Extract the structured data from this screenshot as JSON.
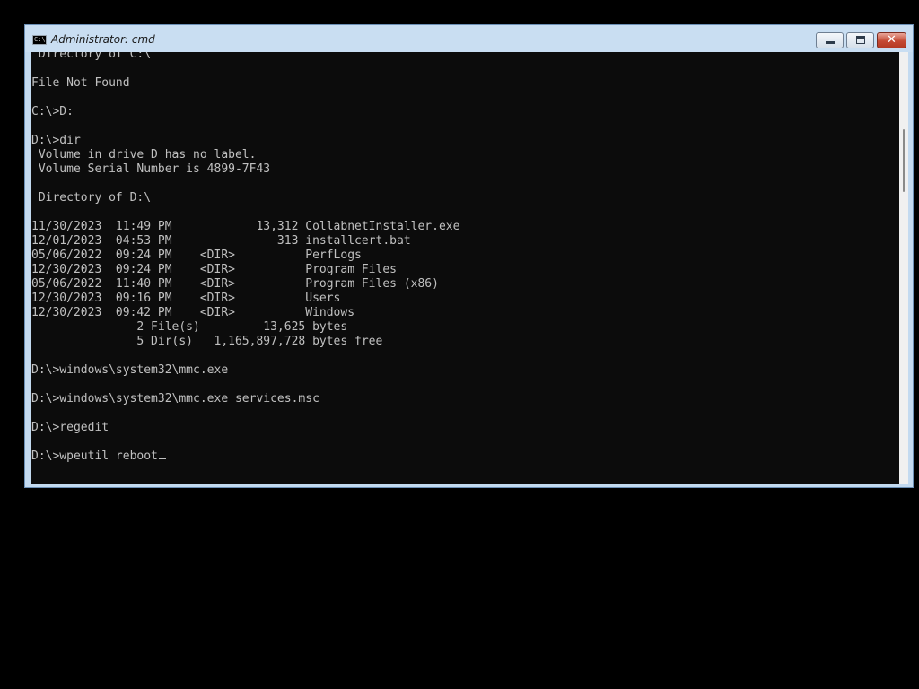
{
  "window": {
    "title": "Administrator: cmd",
    "icon_label": "C:\\"
  },
  "console": {
    "lines": [
      " Directory of C:\\",
      "",
      "File Not Found",
      "",
      "C:\\>D:",
      "",
      "D:\\>dir",
      " Volume in drive D has no label.",
      " Volume Serial Number is 4899-7F43",
      "",
      " Directory of D:\\",
      "",
      "11/30/2023  11:49 PM            13,312 CollabnetInstaller.exe",
      "12/01/2023  04:53 PM               313 installcert.bat",
      "05/06/2022  09:24 PM    <DIR>          PerfLogs",
      "12/30/2023  09:24 PM    <DIR>          Program Files",
      "05/06/2022  11:40 PM    <DIR>          Program Files (x86)",
      "12/30/2023  09:16 PM    <DIR>          Users",
      "12/30/2023  09:42 PM    <DIR>          Windows",
      "               2 File(s)         13,625 bytes",
      "               5 Dir(s)   1,165,897,728 bytes free",
      "",
      "D:\\>windows\\system32\\mmc.exe",
      "",
      "D:\\>windows\\system32\\mmc.exe services.msc",
      "",
      "D:\\>regedit",
      "",
      "D:\\>wpeutil reboot"
    ]
  },
  "icons": {
    "window_icon": "cmd-icon",
    "minimize": "minimize-icon",
    "maximize": "maximize-icon",
    "close": "close-icon"
  },
  "colors": {
    "console_bg": "#0c0c0c",
    "console_text": "#c0c0c0",
    "frame": "#c3daf0",
    "close_button": "#c54a33"
  }
}
